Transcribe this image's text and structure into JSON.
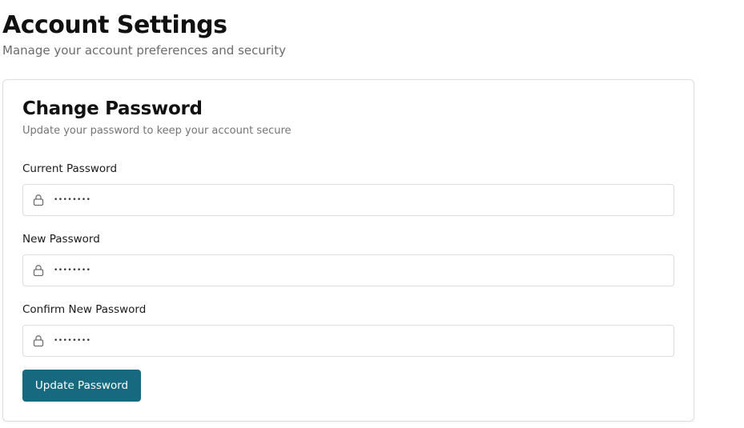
{
  "header": {
    "title": "Account Settings",
    "subtitle": "Manage your account preferences and security"
  },
  "card": {
    "title": "Change Password",
    "subtitle": "Update your password to keep your account secure",
    "fields": [
      {
        "label": "Current Password",
        "value": "••••••••",
        "icon": "lock-icon"
      },
      {
        "label": "New Password",
        "value": "••••••••",
        "icon": "lock-icon"
      },
      {
        "label": "Confirm New Password",
        "value": "••••••••",
        "icon": "lock-icon"
      }
    ],
    "submit_label": "Update Password"
  },
  "colors": {
    "primary_button": "#17697f",
    "border": "#dcdcdc",
    "muted_text": "#6b6b6b"
  }
}
